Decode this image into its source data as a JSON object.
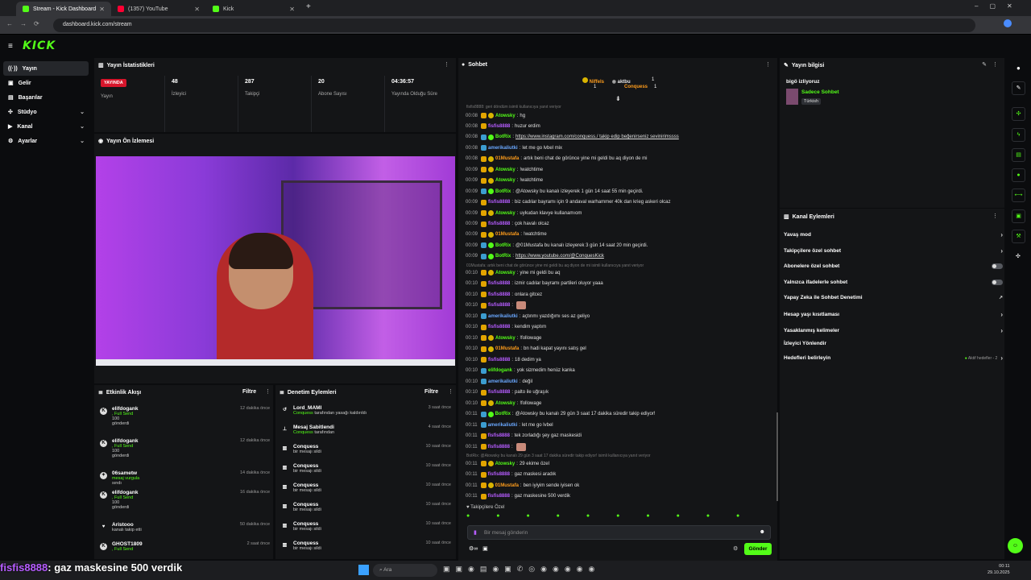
{
  "browser": {
    "tabs": [
      {
        "label": "Stream - Kick Dashboard"
      },
      {
        "label": "(1357) YouTube"
      },
      {
        "label": "Kick"
      }
    ],
    "url": "dashboard.kick.com/stream"
  },
  "brand": {
    "logo": "KICK"
  },
  "sidebar": {
    "items": [
      {
        "label": "Yayın",
        "icon": "broadcast-icon",
        "selected": true
      },
      {
        "label": "Gelir",
        "icon": "wallet-icon"
      },
      {
        "label": "Başarılar",
        "icon": "trophy-icon"
      },
      {
        "label": "Stüdyo",
        "icon": "studio-icon",
        "expand": true
      },
      {
        "label": "Kanal",
        "icon": "channel-icon",
        "expand": true
      },
      {
        "label": "Ayarlar",
        "icon": "gear-icon",
        "expand": true
      }
    ]
  },
  "stats": {
    "title": "Yayın İstatistikleri",
    "live_badge": "YAYINDA",
    "live_label": "Yayın",
    "items": [
      {
        "value": "48",
        "label": "İzleyici"
      },
      {
        "value": "287",
        "label": "Takipçi"
      },
      {
        "value": "20",
        "label": "Abone Sayısı"
      },
      {
        "value": "04:36:57",
        "label": "Yayında Olduğu Süre"
      }
    ]
  },
  "preview": {
    "title": "Yayın Ön İzlemesi"
  },
  "activity": {
    "title": "Etkinlik Akışı",
    "filter": "Filtre",
    "items": [
      {
        "name": "elifdogank",
        "sub": ", Full Send",
        "line3": "100",
        "line4": "gönderdi",
        "time": "12 dakika önce"
      },
      {
        "name": "elifdogank",
        "sub": ", Full Send",
        "line3": "100",
        "line4": "gönderdi",
        "time": "12 dakika önce"
      },
      {
        "name": "06sametw",
        "sub": "mesaj vurgula",
        "line3": "sındı",
        "line4": "",
        "time": "14 dakika önce"
      },
      {
        "name": "elifdogank",
        "sub": ", Full Send",
        "line3": "100",
        "line4": "gönderdi",
        "time": "16 dakika önce"
      },
      {
        "name": "Aristooo",
        "sub": "",
        "line3": "kanalı takip etti",
        "line4": "",
        "time": "50 dakika önce"
      },
      {
        "name": "GHOST1809",
        "sub": ", Full Send",
        "line3": "",
        "line4": "",
        "time": "2 saat önce"
      }
    ]
  },
  "moderation": {
    "title": "Denetim Eylemleri",
    "filter": "Filtre",
    "items": [
      {
        "name": "Lord_MAMI",
        "who": "Conquess",
        "desc": "tarafından yasağı kaldırıldı",
        "time": "3 saat önce"
      },
      {
        "name": "Mesaj Sabitlendi",
        "who": "Conquess",
        "desc": "tarafından",
        "time": "4 saat önce"
      },
      {
        "name": "Conquess",
        "who": "",
        "desc": "bir mesajı sildi",
        "time": "10 saat önce"
      },
      {
        "name": "Conquess",
        "who": "",
        "desc": "bir mesajı sildi",
        "time": "10 saat önce"
      },
      {
        "name": "Conquess",
        "who": "",
        "desc": "bir mesajı sildi",
        "time": "10 saat önce"
      },
      {
        "name": "Conquess",
        "who": "",
        "desc": "bir mesajı sildi",
        "time": "10 saat önce"
      },
      {
        "name": "Conquess",
        "who": "",
        "desc": "bir mesajı sildi",
        "time": "10 saat önce"
      },
      {
        "name": "Conquess",
        "who": "",
        "desc": "bir mesajı sildi",
        "time": "10 saat önce"
      }
    ]
  },
  "chat": {
    "title": "Sohbet",
    "top": {
      "first_name": "Niffels",
      "first_count": "1",
      "second_name": "aktbu",
      "second_count": "1",
      "third_name": "Conquess",
      "third_count": "1"
    },
    "system_top": "fisfis8888: geri döndüm isimli kullanıcıya yanıt veriyor",
    "messages": [
      {
        "t": "00:08",
        "u": "Atowsky",
        "c": "#53fc18",
        "m": "hg"
      },
      {
        "t": "00:08",
        "u": "fisfis8888",
        "c": "#b65cff",
        "m": "huzur erdim"
      },
      {
        "t": "00:08",
        "u": "BotRix",
        "c": "#53fc18",
        "m": "https://www.instagram.com/conquess./ takip edip beğenirseniz sevinirimssss"
      },
      {
        "t": "00:08",
        "u": "amerikaliutki",
        "c": "#6aa8ff",
        "m": "let me go lvbel mix"
      },
      {
        "t": "00:08",
        "u": "01Mustafa",
        "c": "#ff9d1c",
        "m": "artık beni chat de görünce yine mi geldi bu aq diyon de mi"
      },
      {
        "t": "00:09",
        "u": "Atowsky",
        "c": "#53fc18",
        "m": "!watchtime"
      },
      {
        "t": "00:09",
        "u": "Atowsky",
        "c": "#53fc18",
        "m": "!watchtime"
      },
      {
        "t": "00:09",
        "u": "BotRix",
        "c": "#53fc18",
        "m": "@Atowsky bu kanalı izleyerek 1 gün 14 saat 55 min geçirdi."
      },
      {
        "t": "00:09",
        "u": "fisfis8888",
        "c": "#b65cff",
        "m": "biz cadılar bayramı için 9 andaval warhammer 40k dan krieg askeri olcaz"
      },
      {
        "t": "00:09",
        "u": "Atowsky",
        "c": "#53fc18",
        "m": "uykudan klavye kullanamıom"
      },
      {
        "t": "00:09",
        "u": "fisfis8888",
        "c": "#b65cff",
        "m": "çok havalı olcaz"
      },
      {
        "t": "00:09",
        "u": "01Mustafa",
        "c": "#ff9d1c",
        "m": "!watchtime"
      },
      {
        "t": "00:09",
        "u": "BotRix",
        "c": "#53fc18",
        "m": "@01Mustafa bu kanalı izleyerek 3 gün 14 saat 20 min geçirdi."
      },
      {
        "t": "00:09",
        "u": "BotRix",
        "c": "#53fc18",
        "m": "https://www.youtube.com/@ConquesKick"
      }
    ],
    "system_mid": "01Mustafa: artık beni chat de görünce yine mi geldi bu aq diyon de mi isimli kullanıcıya yanıt veriyor",
    "messages2": [
      {
        "t": "00:10",
        "u": "Atowsky",
        "c": "#53fc18",
        "m": "yine mi geldi bu aq"
      },
      {
        "t": "00:10",
        "u": "fisfis8888",
        "c": "#b65cff",
        "m": "izmir cadılar bayramı partileri oluyor yaaa"
      },
      {
        "t": "00:10",
        "u": "fisfis8888",
        "c": "#b65cff",
        "m": "onlara gitcez"
      },
      {
        "t": "00:10",
        "u": "fisfis8888",
        "c": "#b65cff",
        "m": ""
      },
      {
        "t": "00:10",
        "u": "amerikaliutki",
        "c": "#6aa8ff",
        "m": "açtınmı yazdığımı ses az geliyo"
      },
      {
        "t": "00:10",
        "u": "fisfis8888",
        "c": "#b65cff",
        "m": "kendim yaptım"
      },
      {
        "t": "00:10",
        "u": "Atowsky",
        "c": "#53fc18",
        "m": "!followage"
      },
      {
        "t": "00:10",
        "u": "01Mustafa",
        "c": "#ff9d1c",
        "m": "bn hadi kapat yayını satış gel"
      },
      {
        "t": "00:10",
        "u": "fisfis8888",
        "c": "#b65cff",
        "m": "18 dedim ya"
      },
      {
        "t": "00:10",
        "u": "elifdogank",
        "c": "#53fc18",
        "m": "yok sizmedim henüz kanka"
      },
      {
        "t": "00:10",
        "u": "amerikaliutki",
        "c": "#6aa8ff",
        "m": "değil"
      },
      {
        "t": "00:10",
        "u": "fisfis8888",
        "c": "#b65cff",
        "m": "palto ile uğraşık"
      },
      {
        "t": "00:10",
        "u": "Atowsky",
        "c": "#53fc18",
        "m": "!followage"
      },
      {
        "t": "00:11",
        "u": "BotRix",
        "c": "#53fc18",
        "m": "@Atowsky bu kanalı 29 gün 3 saat 17 dakika süredir takip ediyor!"
      },
      {
        "t": "00:11",
        "u": "amerikaliutki",
        "c": "#6aa8ff",
        "m": "let me go lvbel"
      },
      {
        "t": "00:11",
        "u": "fisfis8888",
        "c": "#b65cff",
        "m": "tek zorladığı şey gaz maskesidi"
      },
      {
        "t": "00:11",
        "u": "fisfis8888",
        "c": "#b65cff",
        "m": ""
      }
    ],
    "system_bottom": "BotRix: @Atowsky bu kanalı 29 gün 3 saat 17 dakika süredir takip ediyor! isimli kullanıcıya yanıt veriyor",
    "messages3": [
      {
        "t": "00:11",
        "u": "Atowsky",
        "c": "#53fc18",
        "m": "29 ekime özel"
      },
      {
        "t": "00:11",
        "u": "fisfis8888",
        "c": "#b65cff",
        "m": "gaz maskesi aradık"
      },
      {
        "t": "00:11",
        "u": "01Mustafa",
        "c": "#ff9d1c",
        "m": "ben iyiyim sende iyisen ok"
      },
      {
        "t": "00:11",
        "u": "fisfis8888",
        "c": "#b65cff",
        "m": "gaz maskesine 500 verdik"
      }
    ],
    "followers_only": "Takipçilere Özel",
    "placeholder": "Bir mesaj gönderin",
    "send": "Gönder"
  },
  "streaminfo": {
    "title": "Yayın bilgisi",
    "stream_title": "bigö izliyoruz",
    "category": "Sadece Sohbet",
    "tag": "Türkish"
  },
  "actions": {
    "title": "Kanal Eylemleri",
    "items": [
      {
        "label": "Yavaş mod",
        "ctrl": "chev"
      },
      {
        "label": "Takipçilere özel sohbet",
        "ctrl": "chev"
      },
      {
        "label": "Abonelere özel sohbet",
        "ctrl": "toggle"
      },
      {
        "label": "Yalnızca ifadelerle sohbet",
        "ctrl": "toggle"
      },
      {
        "label": "Yapay Zeka ile Sohbet Denetimi",
        "ctrl": "ext"
      },
      {
        "label": "Hesap yaşı kısıtlaması",
        "ctrl": "chev"
      },
      {
        "label": "Yasaklanmış kelimeler",
        "ctrl": "chev"
      },
      {
        "label": "İzleyici Yönlendir",
        "ctrl": "none"
      },
      {
        "label": "Hedefleri belirleyin",
        "ctrl": "goal"
      }
    ],
    "goal_status": "Aktif hedefler - 2"
  },
  "overlay": {
    "user": "fisfis8888",
    "text": ": gaz maskesine 500 verdik"
  },
  "taskbar": {
    "search": "Ara",
    "time": "00:11",
    "date": "29.10.2025"
  },
  "colors": {
    "brand": "#53fc18",
    "live": "#d6162c",
    "panel": "#141517"
  }
}
